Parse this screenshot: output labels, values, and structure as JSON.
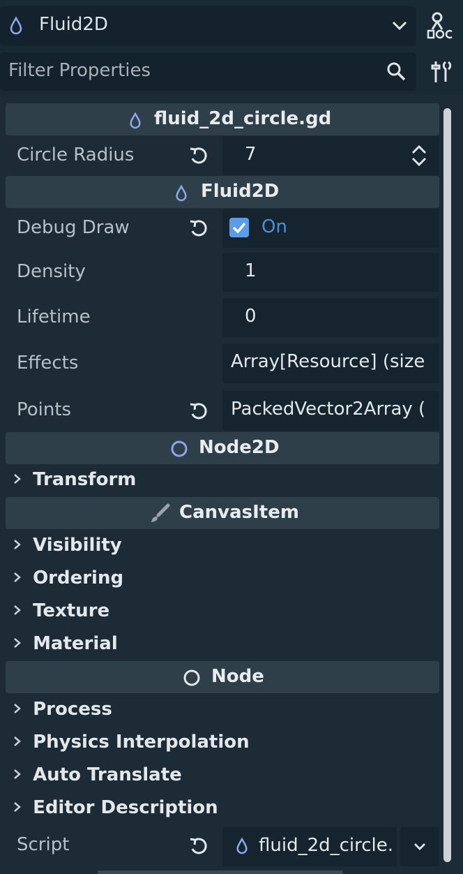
{
  "header": {
    "node_name": "Fluid2D",
    "filter_placeholder": "Filter Properties"
  },
  "sections": {
    "script": "fluid_2d_circle.gd",
    "fluid2d": "Fluid2D",
    "node2d": "Node2D",
    "canvasitem": "CanvasItem",
    "node": "Node"
  },
  "props": {
    "circle_radius": {
      "label": "Circle Radius",
      "value": "7"
    },
    "debug_draw": {
      "label": "Debug Draw",
      "value": "On"
    },
    "density": {
      "label": "Density",
      "value": "1"
    },
    "lifetime": {
      "label": "Lifetime",
      "value": "0"
    },
    "effects": {
      "label": "Effects",
      "value": "Array[Resource] (size"
    },
    "points": {
      "label": "Points",
      "value": "PackedVector2Array ("
    },
    "script": {
      "label": "Script",
      "value": "fluid_2d_circle."
    }
  },
  "groups": {
    "transform": "Transform",
    "visibility": "Visibility",
    "ordering": "Ordering",
    "texture": "Texture",
    "material": "Material",
    "process": "Process",
    "physics_interpolation": "Physics Interpolation",
    "auto_translate": "Auto Translate",
    "editor_description": "Editor Description"
  },
  "colors": {
    "accent_blue": "#4a90d9",
    "icon_purple": "#8fa4ec",
    "section_bg": "#2f3f4a",
    "field_bg": "#15242e"
  }
}
